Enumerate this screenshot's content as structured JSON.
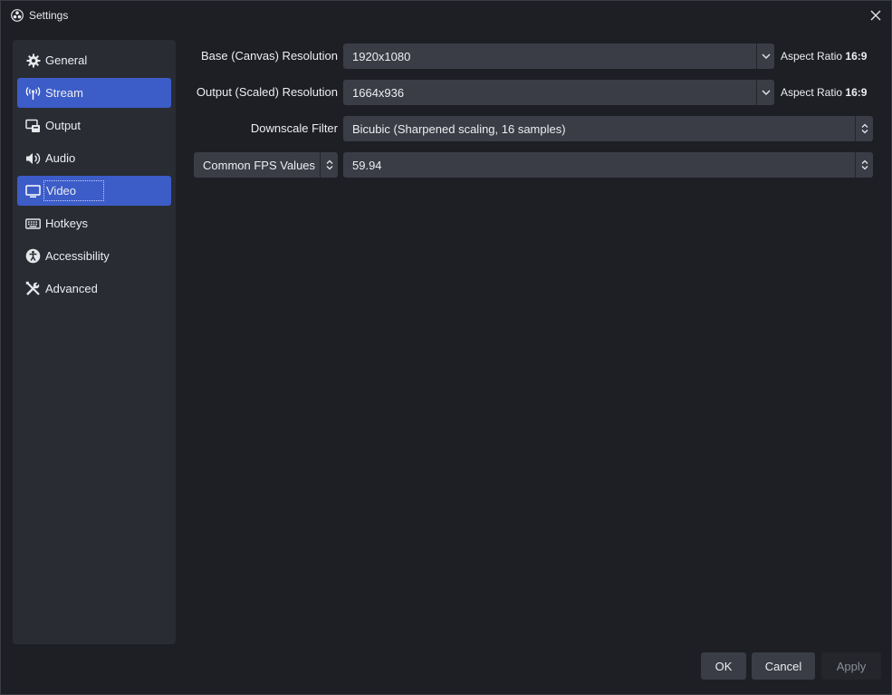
{
  "window": {
    "title": "Settings"
  },
  "sidebar": {
    "items": [
      {
        "label": "General",
        "icon": "gear-icon"
      },
      {
        "label": "Stream",
        "icon": "broadcast-icon"
      },
      {
        "label": "Output",
        "icon": "output-icon"
      },
      {
        "label": "Audio",
        "icon": "speaker-icon"
      },
      {
        "label": "Video",
        "icon": "monitor-icon"
      },
      {
        "label": "Hotkeys",
        "icon": "keyboard-icon"
      },
      {
        "label": "Accessibility",
        "icon": "accessibility-icon"
      },
      {
        "label": "Advanced",
        "icon": "tools-icon"
      }
    ],
    "highlighted": [
      "Stream",
      "Video"
    ],
    "focused": "Video"
  },
  "video": {
    "base_resolution": {
      "label": "Base (Canvas) Resolution",
      "value": "1920x1080",
      "aspect_prefix": "Aspect Ratio",
      "aspect_value": "16:9"
    },
    "output_resolution": {
      "label": "Output (Scaled) Resolution",
      "value": "1664x936",
      "aspect_prefix": "Aspect Ratio",
      "aspect_value": "16:9"
    },
    "downscale_filter": {
      "label": "Downscale Filter",
      "value": "Bicubic (Sharpened scaling, 16 samples)"
    },
    "fps": {
      "type_label": "Common FPS Values",
      "value": "59.94"
    }
  },
  "footer": {
    "ok": "OK",
    "cancel": "Cancel",
    "apply": "Apply"
  },
  "colors": {
    "accent": "#3c5cc8",
    "panel": "#2a2c33",
    "background": "#1e1f25",
    "control": "#3a3d46"
  }
}
